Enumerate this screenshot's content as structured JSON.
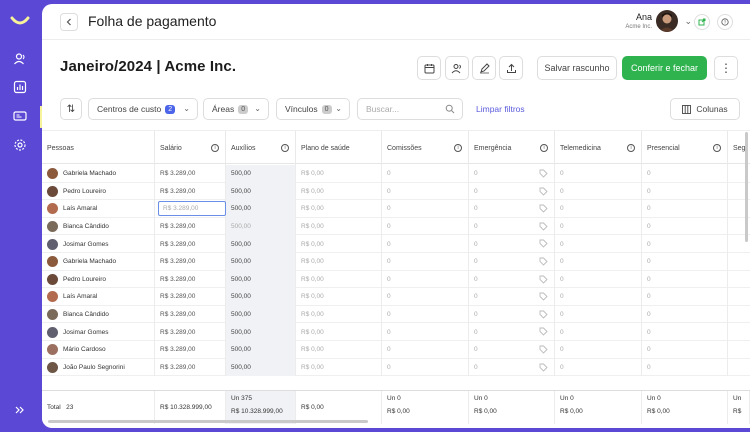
{
  "header": {
    "title": "Folha de pagamento",
    "user_name": "Ana",
    "user_company": "Acme Inc."
  },
  "page": {
    "heading": "Janeiro/2024 | Acme Inc.",
    "draft_label": "Salvar rascunho",
    "confirm_label": "Conferir e fechar"
  },
  "filters": {
    "cost_centers_label": "Centros de custo",
    "cost_centers_count": "2",
    "areas_label": "Áreas",
    "areas_count": "0",
    "bonds_label": "Vínculos",
    "bonds_count": "0",
    "search_placeholder": "Buscar...",
    "clear_label": "Limpar filtros",
    "columns_label": "Colunas"
  },
  "columns": [
    "Pessoas",
    "Salário",
    "Auxílios",
    "Plano de saúde",
    "Comissões",
    "Emergência",
    "Telemedicina",
    "Presencial",
    "Seg"
  ],
  "rows": [
    {
      "name": "Gabriela Machado",
      "salary": "R$ 3.289,00",
      "aux": "500,00",
      "health": "R$ 0,00",
      "commission": "0",
      "emergency": "0",
      "telemed": "0",
      "presencial": "0"
    },
    {
      "name": "Pedro Loureiro",
      "salary": "R$ 3.289,00",
      "aux": "500,00",
      "health": "R$ 0,00",
      "commission": "0",
      "emergency": "0",
      "telemed": "0",
      "presencial": "0"
    },
    {
      "name": "Laís Amaral",
      "salary": "R$ 3.289,00",
      "aux": "500,00",
      "health": "R$ 0,00",
      "commission": "0",
      "emergency": "0",
      "telemed": "0",
      "presencial": "0"
    },
    {
      "name": "Bianca Cândido",
      "salary": "R$ 3.289,00",
      "aux": "500,00",
      "health": "R$ 0,00",
      "commission": "0",
      "emergency": "0",
      "telemed": "0",
      "presencial": "0"
    },
    {
      "name": "Josimar Gomes",
      "salary": "R$ 3.289,00",
      "aux": "500,00",
      "health": "R$ 0,00",
      "commission": "0",
      "emergency": "0",
      "telemed": "0",
      "presencial": "0"
    },
    {
      "name": "Gabriela Machado",
      "salary": "R$ 3.289,00",
      "aux": "500,00",
      "health": "R$ 0,00",
      "commission": "0",
      "emergency": "0",
      "telemed": "0",
      "presencial": "0"
    },
    {
      "name": "Pedro Loureiro",
      "salary": "R$ 3.289,00",
      "aux": "500,00",
      "health": "R$ 0,00",
      "commission": "0",
      "emergency": "0",
      "telemed": "0",
      "presencial": "0"
    },
    {
      "name": "Laís Amaral",
      "salary": "R$ 3.289,00",
      "aux": "500,00",
      "health": "R$ 0,00",
      "commission": "0",
      "emergency": "0",
      "telemed": "0",
      "presencial": "0"
    },
    {
      "name": "Bianca Cândido",
      "salary": "R$ 3.289,00",
      "aux": "500,00",
      "health": "R$ 0,00",
      "commission": "0",
      "emergency": "0",
      "telemed": "0",
      "presencial": "0"
    },
    {
      "name": "Josimar Gomes",
      "salary": "R$ 3.289,00",
      "aux": "500,00",
      "health": "R$ 0,00",
      "commission": "0",
      "emergency": "0",
      "telemed": "0",
      "presencial": "0"
    },
    {
      "name": "Mário Cardoso",
      "salary": "R$ 3.289,00",
      "aux": "500,00",
      "health": "R$ 0,00",
      "commission": "0",
      "emergency": "0",
      "telemed": "0",
      "presencial": "0"
    },
    {
      "name": "João Paulo Segnorini",
      "salary": "R$ 3.289,00",
      "aux": "500,00",
      "health": "R$ 0,00",
      "commission": "0",
      "emergency": "0",
      "telemed": "0",
      "presencial": "0"
    }
  ],
  "editing_value": "R$ 3.289,00",
  "totals": {
    "label": "Total",
    "count": "23",
    "salary": "R$ 10.328.999,00",
    "aux_units": "Un 375",
    "aux_value": "R$ 10.328.999,00",
    "health": "R$ 0,00",
    "commission_units": "Un 0",
    "commission_value": "R$ 0,00",
    "emergency_units": "Un 0",
    "emergency_value": "R$ 0,00",
    "telemed_units": "Un 0",
    "telemed_value": "R$ 0,00",
    "presencial_units": "Un 0",
    "presencial_value": "R$ 0,00",
    "seg_units": "Un",
    "seg_value": "R$"
  },
  "colors": {
    "rail": "#5b49d6",
    "confirm": "#2fb34f",
    "link": "#5a5adc",
    "badge_active": "#4b64e8"
  }
}
